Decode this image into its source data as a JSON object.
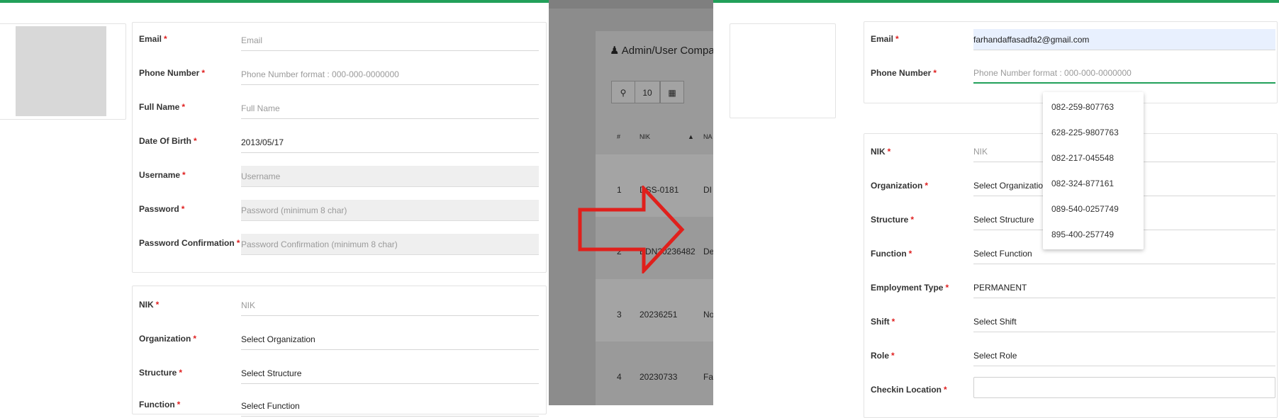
{
  "left_form": {
    "fields": [
      {
        "label": "Email",
        "value": "",
        "placeholder": "Email"
      },
      {
        "label": "Phone Number",
        "value": "",
        "placeholder": "Phone Number format : 000-000-0000000"
      },
      {
        "label": "Full Name",
        "value": "",
        "placeholder": "Full Name"
      },
      {
        "label": "Date Of Birth",
        "value": "2013/05/17",
        "placeholder": ""
      },
      {
        "label": "Username",
        "value": "",
        "placeholder": "Username"
      },
      {
        "label": "Password",
        "value": "",
        "placeholder": "Password (minimum 8 char)"
      },
      {
        "label": "Password Confirmation",
        "value": "",
        "placeholder": "Password Confirmation (minimum 8 char)"
      }
    ],
    "job_fields": [
      {
        "label": "NIK",
        "value": "",
        "placeholder": "NIK"
      },
      {
        "label": "Organization",
        "value": "Select Organization"
      },
      {
        "label": "Structure",
        "value": "Select Structure"
      },
      {
        "label": "Function",
        "value": "Select Function"
      }
    ]
  },
  "middle": {
    "title": "Admin/User Compa",
    "page_size": "10",
    "headers": [
      "#",
      "NIK",
      "NA"
    ],
    "rows": [
      {
        "no": "1",
        "nik": "DSS-0181",
        "name": "DI"
      },
      {
        "no": "2",
        "nik": "EDN20236482",
        "name": "De"
      },
      {
        "no": "3",
        "nik": "20236251",
        "name": "No"
      },
      {
        "no": "4",
        "nik": "20230733",
        "name": "Fa"
      }
    ]
  },
  "right_form": {
    "fields": [
      {
        "label": "Email",
        "value": "farhandaffasadfa2@gmail.com"
      },
      {
        "label": "Phone Number",
        "value": "",
        "placeholder": "Phone Number format : 000-000-0000000"
      }
    ],
    "job_fields": [
      {
        "label": "NIK",
        "value": "",
        "placeholder": "NIK"
      },
      {
        "label": "Organization",
        "value": "Select Organization"
      },
      {
        "label": "Structure",
        "value": "Select Structure"
      },
      {
        "label": "Function",
        "value": "Select Function"
      },
      {
        "label": "Employment Type",
        "value": "PERMANENT"
      },
      {
        "label": "Shift",
        "value": "Select Shift"
      },
      {
        "label": "Role",
        "value": "Select Role"
      },
      {
        "label": "Checkin Location",
        "value": ""
      }
    ],
    "phone_suggestions": [
      "082-259-807763",
      "628-225-9807763",
      "082-217-045548",
      "082-324-877161",
      "089-540-0257749",
      "895-400-257749"
    ]
  },
  "colors": {
    "accent": "#22a05a",
    "required": "#e02020",
    "arrow": "#e0201c",
    "overlay": "#8c8c8c"
  },
  "icons": [
    "search-icon",
    "grid-icon",
    "user-icon",
    "sort-asc-icon",
    "arrow-right-icon"
  ]
}
